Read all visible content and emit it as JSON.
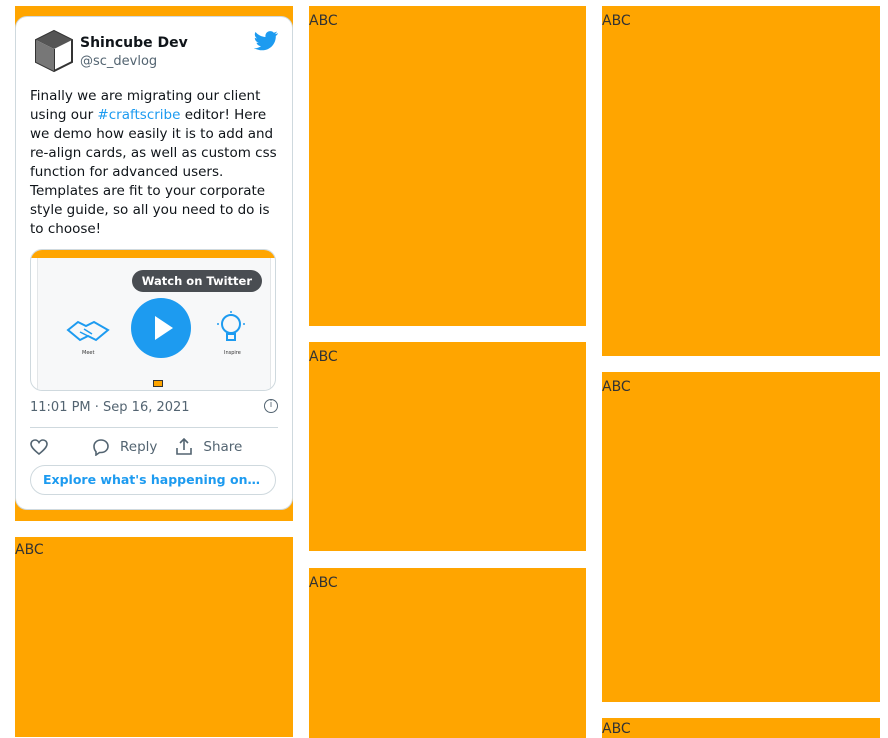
{
  "colors": {
    "card": "#ffa500",
    "twitter_blue": "#1d9bf0"
  },
  "cards": {
    "label": "ABC"
  },
  "tweet": {
    "display_name": "Shincube Dev",
    "handle": "@sc_devlog",
    "text_before": "Finally we are migrating our client using our ",
    "hashtag": "#craftscribe",
    "text_after": " editor! Here we demo how easily it is to add and re-align cards, as well as custom css function for advanced users. Templates are fit to your corporate style guide, so all you need to do is to choose!",
    "media": {
      "watch_label": "Watch on Twitter",
      "icon_left": "handshake-icon",
      "icon_right": "lightbulb-icon",
      "caption_left": "Meet",
      "caption_right": "Inspire"
    },
    "timestamp": "11:01 PM · Sep 16, 2021",
    "actions": {
      "like_icon": "heart-icon",
      "reply_label": "Reply",
      "share_label": "Share"
    },
    "explore_label": "Explore what's happening on T..."
  }
}
